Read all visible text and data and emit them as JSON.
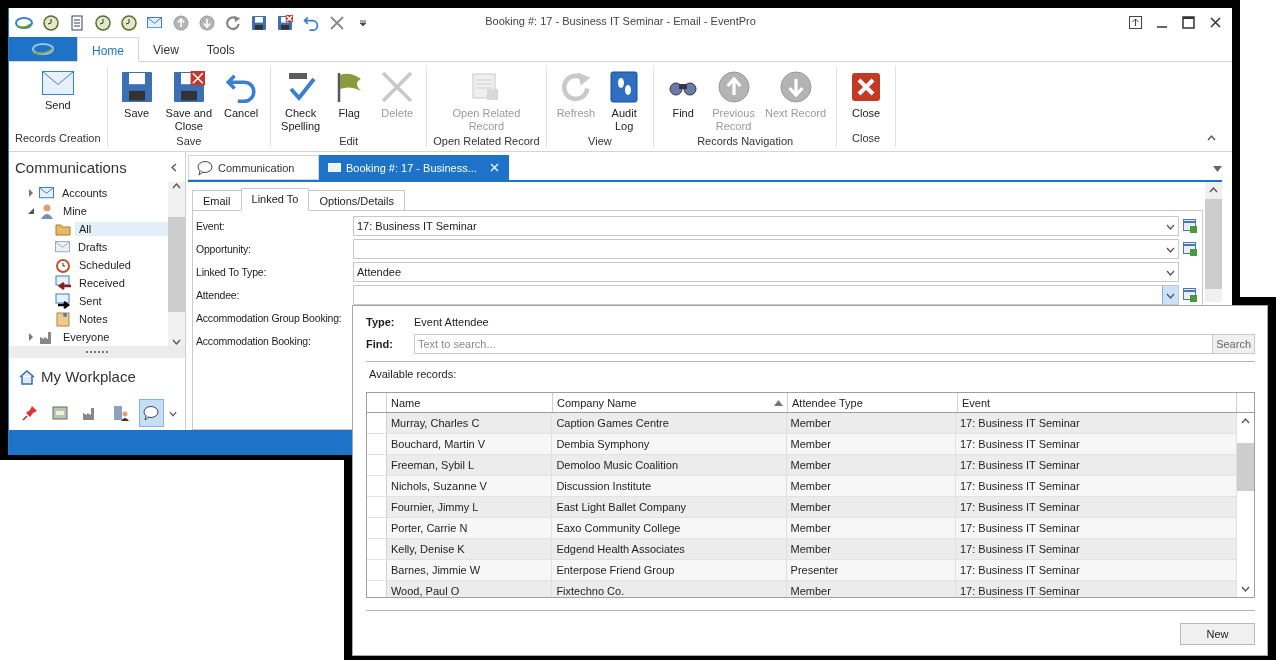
{
  "window": {
    "title": "Booking #: 17 - Business IT Seminar - Email - EventPro"
  },
  "ribbon": {
    "tabs": [
      {
        "label": "Home",
        "selected": true
      },
      {
        "label": "View",
        "selected": false
      },
      {
        "label": "Tools",
        "selected": false
      }
    ],
    "groups": [
      {
        "label": "Records Creation",
        "buttons": [
          {
            "label": "Send",
            "disabled": false
          }
        ]
      },
      {
        "label": "Save",
        "buttons": [
          {
            "label": "Save",
            "disabled": false
          },
          {
            "label": "Save and\nClose",
            "disabled": false
          },
          {
            "label": "Cancel",
            "disabled": false
          }
        ]
      },
      {
        "label": "Edit",
        "buttons": [
          {
            "label": "Check\nSpelling",
            "disabled": false
          },
          {
            "label": "Flag",
            "disabled": false
          },
          {
            "label": "Delete",
            "disabled": true
          }
        ]
      },
      {
        "label": "Open Related Record",
        "buttons": [
          {
            "label": "Open Related\nRecord",
            "disabled": true
          }
        ]
      },
      {
        "label": "View",
        "buttons": [
          {
            "label": "Refresh",
            "disabled": true
          },
          {
            "label": "Audit\nLog",
            "disabled": false
          }
        ]
      },
      {
        "label": "Records Navigation",
        "buttons": [
          {
            "label": "Find",
            "disabled": false
          },
          {
            "label": "Previous\nRecord",
            "disabled": true
          },
          {
            "label": "Next Record",
            "disabled": true
          }
        ]
      },
      {
        "label": "Close",
        "buttons": [
          {
            "label": "Close",
            "disabled": false
          }
        ]
      }
    ]
  },
  "nav": {
    "title": "Communications",
    "tree": [
      {
        "label": "Accounts",
        "expanded": false,
        "selected": false
      },
      {
        "label": "Mine",
        "expanded": true,
        "selected": false,
        "children": [
          {
            "label": "All",
            "selected": true
          },
          {
            "label": "Drafts",
            "selected": false
          },
          {
            "label": "Scheduled",
            "selected": false
          },
          {
            "label": "Received",
            "selected": false
          },
          {
            "label": "Sent",
            "selected": false
          },
          {
            "label": "Notes",
            "selected": false
          }
        ]
      },
      {
        "label": "Everyone",
        "expanded": false,
        "selected": false
      }
    ],
    "workplace": "My Workplace",
    "shortcuts": [
      {
        "selected": false
      },
      {
        "selected": false
      },
      {
        "selected": false
      },
      {
        "selected": false
      },
      {
        "selected": true
      }
    ]
  },
  "document_tabs": [
    {
      "label": "Communication",
      "selected": false
    },
    {
      "label": "Booking #: 17 - Business...",
      "selected": true
    }
  ],
  "form_tabs": [
    {
      "label": "Email",
      "selected": false
    },
    {
      "label": "Linked To",
      "selected": true
    },
    {
      "label": "Options/Details",
      "selected": false
    }
  ],
  "fields": [
    {
      "label": "Event:",
      "value": "17: Business IT Seminar",
      "kind": "lookup",
      "open": false
    },
    {
      "label": "Opportunity:",
      "kind": "lookup",
      "open": false
    },
    {
      "label": "Linked To Type:",
      "value": "Attendee",
      "kind": "dropdown",
      "open": false
    },
    {
      "label": "Attendee:",
      "kind": "lookup",
      "open": true
    },
    {
      "label": "Accommodation Group Booking:"
    },
    {
      "label": "Accommodation Booking:"
    }
  ],
  "lookup_popup": {
    "type_label": "Type:",
    "type_value": "Event Attendee",
    "find_label": "Find:",
    "find_placeholder": "Text to search...",
    "search_button": "Search",
    "records_label": "Available records:",
    "columns": [
      {
        "label": "Name",
        "sorted": false
      },
      {
        "label": "Company Name",
        "sorted": true
      },
      {
        "label": "Attendee Type",
        "sorted": false
      },
      {
        "label": "Event",
        "sorted": false
      }
    ],
    "rows": [
      [
        "Murray, Charles C",
        "Caption Games Centre",
        "Member",
        "17: Business IT Seminar"
      ],
      [
        "Bouchard, Martin V",
        "Dembia Symphony",
        "Member",
        "17: Business IT Seminar"
      ],
      [
        "Freeman, Sybil L",
        "Demoloo Music Coalition",
        "Member",
        "17: Business IT Seminar"
      ],
      [
        "Nichols, Suzanne V",
        "Discussion Institute",
        "Member",
        "17: Business IT Seminar"
      ],
      [
        "Fournier, Jimmy L",
        "East Light Ballet Company",
        "Member",
        "17: Business IT Seminar"
      ],
      [
        "Porter, Carrie N",
        "Eaxo Community College",
        "Member",
        "17: Business IT Seminar"
      ],
      [
        "Kelly, Denise K",
        "Edgend Health Associates",
        "Member",
        "17: Business IT Seminar"
      ],
      [
        "Barnes, Jimmie W",
        "Enterpose Friend Group",
        "Presenter",
        "17: Business IT Seminar"
      ],
      [
        "Wood, Paul O",
        "Fixtechno Co.",
        "Member",
        "17: Business IT Seminar"
      ]
    ],
    "new_button": "New"
  }
}
